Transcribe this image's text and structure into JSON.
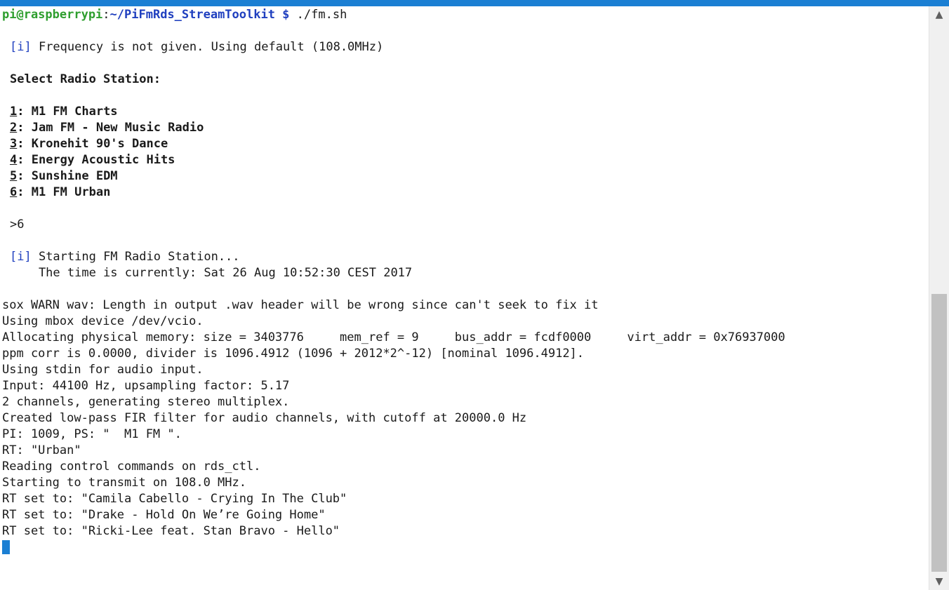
{
  "prompt": {
    "user_host": "pi@raspberrypi",
    "colon": ":",
    "path": "~/PiFmRds_StreamToolkit $",
    "command": " ./fm.sh"
  },
  "info": {
    "tag": "[i]",
    "frequency_msg": " Frequency is not given. Using default (108.0MHz)"
  },
  "select_heading": "Select Radio Station:",
  "stations": [
    {
      "num": "1",
      "name": ": M1 FM Charts"
    },
    {
      "num": "2",
      "name": ": Jam FM - New Music Radio"
    },
    {
      "num": "3",
      "name": ": Kronehit 90's Dance"
    },
    {
      "num": "4",
      "name": ": Energy Acoustic Hits"
    },
    {
      "num": "5",
      "name": ": Sunshine EDM"
    },
    {
      "num": "6",
      "name": ": M1 FM Urban"
    }
  ],
  "input_value": ">6",
  "starting": {
    "tag": "[i]",
    "msg": " Starting FM Radio Station...",
    "time_line": "    The time is currently: Sat 26 Aug 10:52:30 CEST 2017"
  },
  "log_lines": [
    "sox WARN wav: Length in output .wav header will be wrong since can't seek to fix it",
    "Using mbox device /dev/vcio.",
    "Allocating physical memory: size = 3403776     mem_ref = 9     bus_addr = fcdf0000     virt_addr = 0x76937000",
    "ppm corr is 0.0000, divider is 1096.4912 (1096 + 2012*2^-12) [nominal 1096.4912].",
    "Using stdin for audio input.",
    "Input: 44100 Hz, upsampling factor: 5.17",
    "2 channels, generating stereo multiplex.",
    "Created low-pass FIR filter for audio channels, with cutoff at 20000.0 Hz",
    "PI: 1009, PS: \"  M1 FM \".",
    "RT: \"Urban\"",
    "Reading control commands on rds_ctl.",
    "Starting to transmit on 108.0 MHz.",
    "RT set to: \"Camila Cabello - Crying In The Club\"",
    "RT set to: \"Drake - Hold On We’re Going Home\"",
    "RT set to: \"Ricki-Lee feat. Stan Bravo - Hello\""
  ],
  "scrollbar": {
    "up_icon": "▲",
    "down_icon": "▼"
  },
  "colors": {
    "title_bar": "#1b7fd3",
    "prompt_user": "#2e9e2e",
    "prompt_path": "#1f3fbf",
    "cursor": "#1b7fd3"
  }
}
